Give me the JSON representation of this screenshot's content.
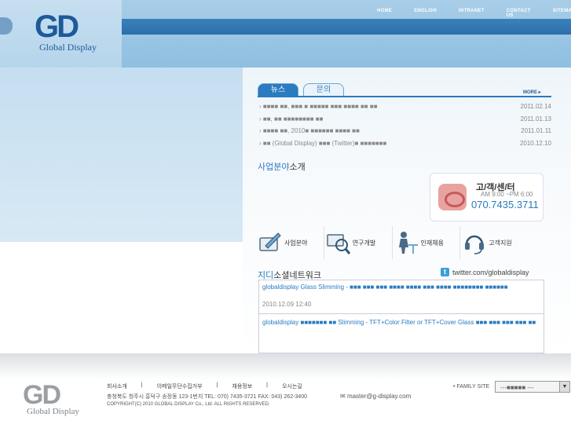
{
  "header": {
    "logo_mark": "GD",
    "logo_text": "Global Display",
    "nav": [
      "HOME",
      "ENGLISH",
      "INTRANET",
      "CONTACT US",
      "SITEMAP"
    ]
  },
  "notice": {
    "tabs": [
      "뉴스",
      "문의"
    ],
    "more": "MORE",
    "items": [
      {
        "title": "■■■■ ■■, ■■■ ■ ■■■■■ ■■■ ■■■■ ■■ ■■",
        "date": "2011.02.14"
      },
      {
        "title": "■■, ■■ ■■■■■■■■ ■■",
        "date": "2011.01.13"
      },
      {
        "title": "■■■■ ■■, 2010■ ■■■■■■ ■■■■ ■■",
        "date": "2011.01.11"
      },
      {
        "title": "■■ (Global Display) ■■■ (Twitter)■ ■■■■■■■",
        "date": "2010.12.10"
      }
    ]
  },
  "business": {
    "title_highlight": "사업분야",
    "title_rest": "소개"
  },
  "customer_service": {
    "title": "고/객/센/터",
    "hours": "AM 9:00 ~PM 6:00",
    "phone": "070.7435.3711"
  },
  "quick_links": [
    "사업분야",
    "연구개발",
    "인재채용",
    "고객지원"
  ],
  "social": {
    "title_highlight": "지디",
    "title_rest": "소셜네트워크",
    "twitter_label": "twitter.com/globaldisplay",
    "posts": [
      {
        "user": "globaldisplay",
        "text": "Glass Slimming - ■■■ ■■■ ■■■ ■■■■ ■■■■ ■■■ ■■■■ ■■■■■■■■ ■■■■■■",
        "date": "2010.12.09 12:40"
      },
      {
        "user": "globaldisplay",
        "text": "■■■■■■■ ■■ Slimming - TFT+Color Filter or TFT+Cover Glass ■■■ ■■■ ■■■ ■■■ ■■",
        "date": ""
      }
    ]
  },
  "footer": {
    "logo_mark": "GD",
    "logo_text": "Global Display",
    "nav": [
      "회사소개",
      "|",
      "이메일무단수집거부",
      "|",
      "채용정보",
      "|",
      "오시는길"
    ],
    "address": "충청북도 청주시 흥덕구 송정동 123-1번지 TEL: 070) 7435-3721  FAX: 043) 262-3400",
    "copyright": "COPYRIGHT(C) 2010 GLOBAL DISPLAY Co., Ltd. ALL RIGHTS RESERVED.",
    "email": "master@g-display.com",
    "family_site_label": "• FAMILY SITE",
    "family_site_value": "---■■■■■ ---"
  }
}
